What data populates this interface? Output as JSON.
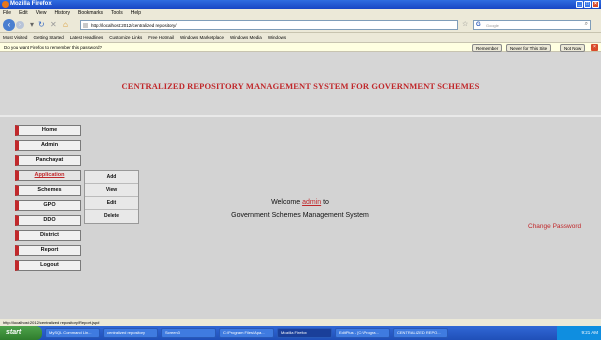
{
  "window": {
    "title": "Mozilla Firefox"
  },
  "menubar": [
    "File",
    "Edit",
    "View",
    "History",
    "Bookmarks",
    "Tools",
    "Help"
  ],
  "navbar": {
    "url": "http://localhost:2012/centralized repository/",
    "search_placeholder": "Google"
  },
  "bookmarks": [
    "Most Visited",
    "Getting Started",
    "Latest Headlines",
    "Customize Links",
    "Free Hotmail",
    "Windows Marketplace",
    "Windows Media",
    "Windows"
  ],
  "notification": {
    "text": "Do you want Firefox to remember this password?",
    "remember": "Remember",
    "never": "Never for This Site",
    "not_now": "Not Now"
  },
  "header": {
    "title": "CENTRALIZED REPOSITORY MANAGEMENT SYSTEM FOR GOVERNMENT SCHEMES"
  },
  "menu": [
    "Home",
    "Admin",
    "Panchayat",
    "Application",
    "Schemes",
    "GPO",
    "DDO",
    "District",
    "Report",
    "Logout"
  ],
  "submenu": [
    "Add",
    "View",
    "Edit",
    "Delete"
  ],
  "welcome": {
    "prefix": "Welcome",
    "user": "admin",
    "suffix": "to",
    "line2": "Government Schemes Management System"
  },
  "change_password": "Change Password",
  "statusbar": "http://localhost:2012/centralized repository/Report.jsp#",
  "taskbar": {
    "start": "start",
    "tasks": [
      "MySQL Command Lin...",
      "centralized repository",
      "Screen3",
      "C:\\Program Files\\Apa...",
      "Mozilla Firefox",
      "EditPlus - [C:\\Progra...",
      "CENTRALIZED REPO..."
    ],
    "clock": "9:21 AM"
  },
  "colors": {
    "accent": "#c0282b",
    "page_bg": "#d3d3d3"
  }
}
